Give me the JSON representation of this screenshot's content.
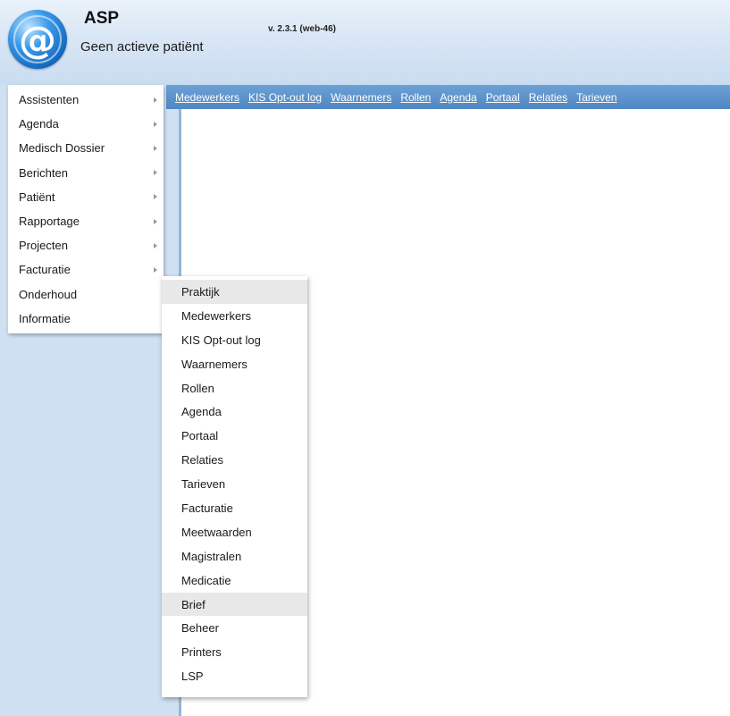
{
  "header": {
    "app_title": "ASP",
    "version": "v. 2.3.1 (web-46)",
    "patient_status": "Geen actieve patiënt",
    "logo_glyph": "@"
  },
  "topnav": {
    "links": [
      "Medewerkers",
      "KIS Opt-out log",
      "Waarnemers",
      "Rollen",
      "Agenda",
      "Portaal",
      "Relaties",
      "Tarieven"
    ]
  },
  "main_menu": {
    "items": [
      {
        "label": "Assistenten",
        "submenu": true
      },
      {
        "label": "Agenda",
        "submenu": true
      },
      {
        "label": "Medisch Dossier",
        "submenu": true
      },
      {
        "label": "Berichten",
        "submenu": true
      },
      {
        "label": "Patiënt",
        "submenu": true
      },
      {
        "label": "Rapportage",
        "submenu": true
      },
      {
        "label": "Projecten",
        "submenu": true
      },
      {
        "label": "Facturatie",
        "submenu": true
      },
      {
        "label": "Onderhoud",
        "submenu": false
      },
      {
        "label": "Informatie",
        "submenu": false
      }
    ]
  },
  "sub_menu": {
    "items": [
      "Praktijk",
      "Medewerkers",
      "KIS Opt-out log",
      "Waarnemers",
      "Rollen",
      "Agenda",
      "Portaal",
      "Relaties",
      "Tarieven",
      "Facturatie",
      "Meetwaarden",
      "Magistralen",
      "Medicatie",
      "Brief",
      "Beheer",
      "Printers",
      "LSP"
    ],
    "highlighted": [
      "Praktijk",
      "Brief"
    ]
  },
  "colors": {
    "header_bg": "#d9e6f5",
    "sidebar_bg": "#cfe0f2",
    "nav_bar": "#5b90c9",
    "nav_link_text": "#ffffff",
    "highlight_bg": "#e8e8e8"
  }
}
